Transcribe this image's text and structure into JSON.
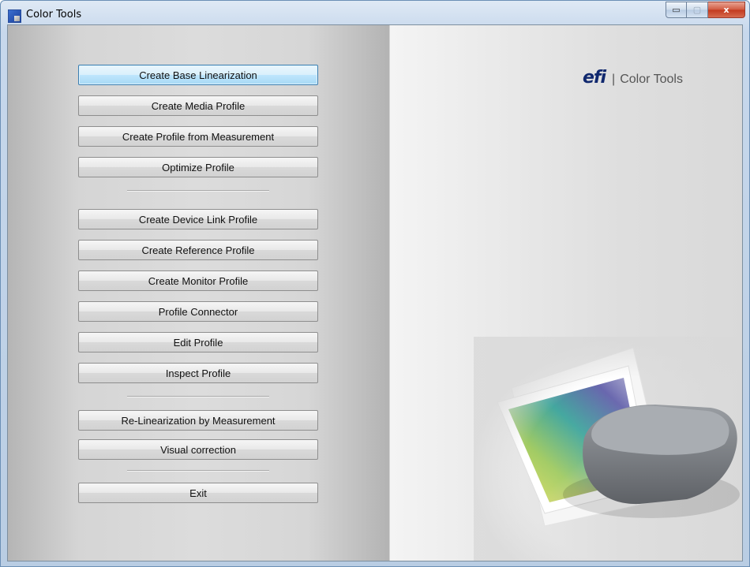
{
  "window": {
    "title": "Color Tools",
    "caption_buttons": {
      "minimize": "▭",
      "maximize": "▢",
      "close": "x"
    }
  },
  "brand": {
    "logo": "efi",
    "divider": "|",
    "product": "Color Tools"
  },
  "buttons": [
    {
      "label": "Create Base Linearization",
      "focused": true
    },
    {
      "label": "Create Media Profile"
    },
    {
      "label": "Create Profile from Measurement"
    },
    {
      "label": "Optimize Profile"
    },
    {
      "label": "Create Device Link Profile"
    },
    {
      "label": "Create Reference Profile"
    },
    {
      "label": "Create Monitor Profile"
    },
    {
      "label": "Profile Connector"
    },
    {
      "label": "Edit Profile"
    },
    {
      "label": "Inspect Profile"
    },
    {
      "label": "Re-Linearization by Measurement"
    },
    {
      "label": "Visual correction"
    },
    {
      "label": "Exit"
    }
  ],
  "colors": {
    "accent_border": "#3c7fb1",
    "logo": "#10286e"
  },
  "icons": {
    "app": "color-tools-app-icon",
    "illustration": "spectrophotometer-on-color-print"
  }
}
